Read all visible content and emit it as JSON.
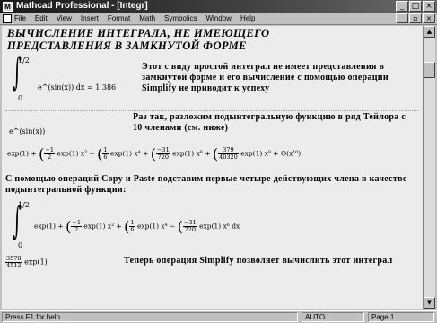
{
  "window": {
    "title": "Mathcad Professional - [Integr]",
    "controls": {
      "minimize": "_",
      "maximize": "□",
      "close": "×"
    }
  },
  "menu": {
    "items": [
      "File",
      "Edit",
      "View",
      "Insert",
      "Format",
      "Math",
      "Symbolics",
      "Window",
      "Help"
    ],
    "doc_controls": {
      "minimize": "_",
      "restore": "▫",
      "close": "×"
    }
  },
  "worksheet": {
    "heading_line1": "ВЫЧИСЛЕНИЕ ИНТЕГРАЛА, НЕ ИМЕЮЩЕГО",
    "heading_line2": "ПРЕДСТАВЛЕНИЯ В ЗАМКНУТОЙ ФОРМЕ",
    "integral1": {
      "upper": "1/2",
      "lower": "0",
      "body": "e^(sin(x)) dx = 1.386"
    },
    "para1": "Этот с виду простой интеграл не имеет представления в замкнутой форме и его вычисление с помощью операции Simplify не приводит к успеху",
    "exp_label": "e^(sin(x))",
    "para2": "Раз так, разложим подынтегральную функцию в ряд Тейлора с 10 членами (см. ниже)",
    "series": {
      "t0": "exp(1) +",
      "t1": "exp(1) x² −",
      "t2": "exp(1) x⁴ +",
      "t3": "exp(1) x⁶ +",
      "t4": "exp(1) x⁸ + O(x¹⁰)",
      "f1_num": "−1",
      "f1_den": "2",
      "f2_num": "1",
      "f2_den": "6",
      "f3_num": "−31",
      "f3_den": "720",
      "f4_num": "379",
      "f4_den": "40320"
    },
    "para3": "С помощью операций Copy и Paste подставим первые четыре действующих члена в качестве подынтегральной функции:",
    "integral2": {
      "upper": "1/2",
      "lower": "0",
      "t0": "exp(1) +",
      "t1": "exp(1) x² +",
      "t2": "exp(1) x⁴ −",
      "t3": "exp(1) x⁶ dx",
      "f1_num": "−1",
      "f1_den": "2",
      "f2_num": "1",
      "f2_den": "6",
      "f3_num": "−31",
      "f3_den": "720"
    },
    "result": {
      "num": "3578",
      "den": "4512",
      "tail": "exp(1)"
    },
    "para4": "Теперь операция Simplify позволяет вычислить этот интеграл"
  },
  "statusbar": {
    "hint": "Press F1 for help.",
    "mode": "AUTO",
    "page": "Page 1"
  },
  "colors": {
    "titlebar": "#1a1a1a",
    "chrome": "#c0c0c0",
    "page": "#ececec"
  }
}
